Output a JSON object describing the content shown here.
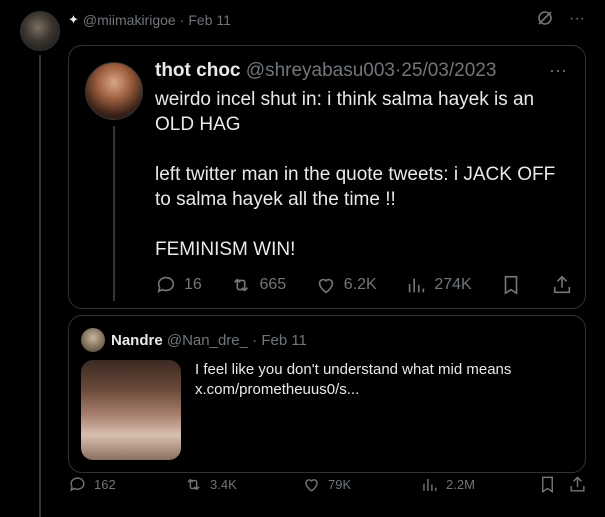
{
  "post": {
    "handle": "@miimakirigoe",
    "date": "Feb 11",
    "sparkle": "✦",
    "dot": "·",
    "more": "···"
  },
  "quote1": {
    "name": "thot choc",
    "handle": "@shreyabasu003",
    "date": "25/03/2023",
    "dot": "·",
    "more": "···",
    "paragraphs": [
      "weirdo incel shut in: i think salma hayek is an OLD HAG",
      "left twitter man in the quote tweets: i JACK OFF to salma hayek all the time !!",
      "FEMINISM WIN!"
    ],
    "actions": {
      "replies": "16",
      "reposts": "665",
      "likes": "6.2K",
      "views": "274K"
    }
  },
  "quote2": {
    "name": "Nandre",
    "handle": "@Nan_dre_",
    "date": "Feb 11",
    "dot": "·",
    "text_line1": "I feel like you don't understand what mid means",
    "text_line2": "x.com/prometheuus0/s..."
  },
  "actions": {
    "replies": "162",
    "reposts": "3.4K",
    "likes": "79K",
    "views": "2.2M"
  },
  "colors": {
    "background": "#000000",
    "text": "#e7e9ea",
    "muted": "#71767b",
    "border": "#2f3336"
  }
}
